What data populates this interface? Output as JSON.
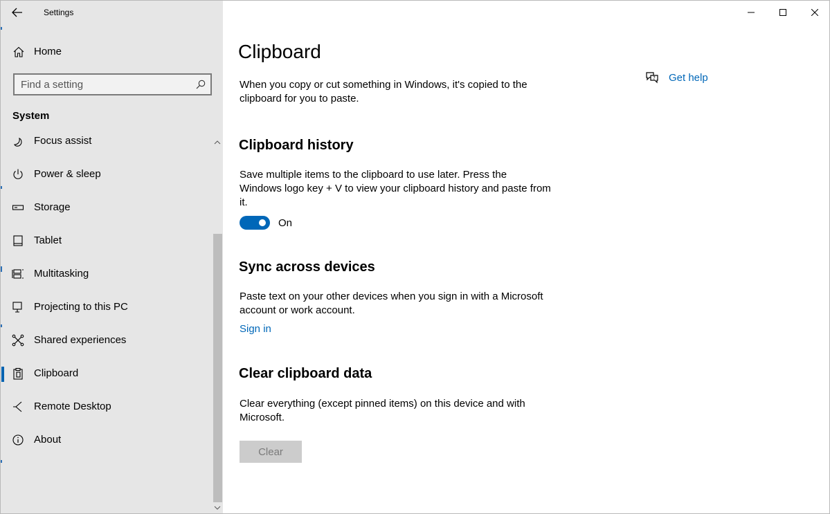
{
  "window": {
    "app_title": "Settings",
    "controls": [
      "minimize",
      "maximize",
      "close"
    ]
  },
  "sidebar": {
    "home_label": "Home",
    "search_placeholder": "Find a setting",
    "section_heading": "System",
    "items": [
      {
        "label": "Focus assist",
        "icon": "moon-icon"
      },
      {
        "label": "Power & sleep",
        "icon": "power-icon"
      },
      {
        "label": "Storage",
        "icon": "storage-icon"
      },
      {
        "label": "Tablet",
        "icon": "tablet-icon"
      },
      {
        "label": "Multitasking",
        "icon": "multitasking-icon"
      },
      {
        "label": "Projecting to this PC",
        "icon": "projecting-icon"
      },
      {
        "label": "Shared experiences",
        "icon": "shared-experiences-icon"
      },
      {
        "label": "Clipboard",
        "icon": "clipboard-icon",
        "active": true
      },
      {
        "label": "Remote Desktop",
        "icon": "remote-desktop-icon"
      },
      {
        "label": "About",
        "icon": "info-icon"
      }
    ]
  },
  "main": {
    "title": "Clipboard",
    "help_label": "Get help",
    "intro": "When you copy or cut something in Windows, it's copied to the clipboard for you to paste.",
    "history": {
      "heading": "Clipboard history",
      "description": "Save multiple items to the clipboard to use later. Press the Windows logo key + V to view your clipboard history and paste from it.",
      "toggle_state": "On"
    },
    "sync": {
      "heading": "Sync across devices",
      "description": "Paste text on your other devices when you sign in with a Microsoft account or work account.",
      "link": "Sign in"
    },
    "clear": {
      "heading": "Clear clipboard data",
      "description": "Clear everything (except pinned items) on this device and with Microsoft.",
      "button": "Clear"
    }
  },
  "colors": {
    "accent": "#0067b8",
    "sidebar_bg": "#e6e6e6",
    "toggle_on": "#0067b8",
    "button_disabled_bg": "#cccccc"
  }
}
